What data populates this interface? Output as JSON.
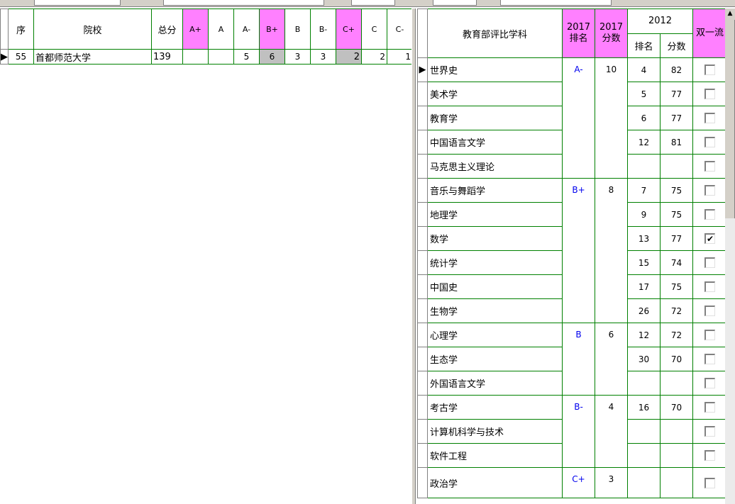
{
  "left_grid": {
    "headers": [
      "序",
      "院校",
      "总分",
      "A+",
      "A",
      "A-",
      "B+",
      "B",
      "B-",
      "C+",
      "C",
      "C-"
    ],
    "row": {
      "seq": "55",
      "school": "首都师范大学",
      "total": "139",
      "a_plus": "",
      "a": "",
      "a_minus": "5",
      "b_plus": "6",
      "b": "3",
      "b_minus": "3",
      "c_plus": "2",
      "c": "2",
      "c_minus": "1"
    }
  },
  "right_grid": {
    "headers": {
      "subject": "教育部评比学科",
      "rank2017": "2017排名",
      "score2017": "2017分数",
      "year2012": "2012",
      "rank2012": "排名",
      "score2012": "分数",
      "double_first": "双一流"
    },
    "groups": [
      {
        "grade": "A-",
        "score": "10",
        "rows": [
          {
            "subject": "世界史",
            "rank": "4",
            "score": "82",
            "checked": false
          },
          {
            "subject": "美术学",
            "rank": "5",
            "score": "77",
            "checked": false
          },
          {
            "subject": "教育学",
            "rank": "6",
            "score": "77",
            "checked": false
          },
          {
            "subject": "中国语言文学",
            "rank": "12",
            "score": "81",
            "checked": false
          },
          {
            "subject": "马克思主义理论",
            "rank": "",
            "score": "",
            "checked": false
          }
        ]
      },
      {
        "grade": "B+",
        "score": "8",
        "rows": [
          {
            "subject": "音乐与舞蹈学",
            "rank": "7",
            "score": "75",
            "checked": false
          },
          {
            "subject": "地理学",
            "rank": "9",
            "score": "75",
            "checked": false
          },
          {
            "subject": "数学",
            "rank": "13",
            "score": "77",
            "checked": true
          },
          {
            "subject": "统计学",
            "rank": "15",
            "score": "74",
            "checked": false
          },
          {
            "subject": "中国史",
            "rank": "17",
            "score": "75",
            "checked": false
          },
          {
            "subject": "生物学",
            "rank": "26",
            "score": "72",
            "checked": false
          }
        ]
      },
      {
        "grade": "B",
        "score": "6",
        "rows": [
          {
            "subject": "心理学",
            "rank": "12",
            "score": "72",
            "checked": false
          },
          {
            "subject": "生态学",
            "rank": "30",
            "score": "70",
            "checked": false
          },
          {
            "subject": "外国语言文学",
            "rank": "",
            "score": "",
            "checked": false
          }
        ]
      },
      {
        "grade": "B-",
        "score": "4",
        "rows": [
          {
            "subject": "考古学",
            "rank": "16",
            "score": "70",
            "checked": false
          },
          {
            "subject": "计算机科学与技术",
            "rank": "",
            "score": "",
            "checked": false
          },
          {
            "subject": "软件工程",
            "rank": "",
            "score": "",
            "checked": false
          }
        ]
      },
      {
        "grade": "C+",
        "score": "3",
        "rows": [
          {
            "subject": "政治学",
            "rank": "",
            "score": "",
            "checked": false
          }
        ]
      }
    ]
  },
  "icons": {
    "row_pointer": "triangle-right-icon",
    "scroll_up": "arrow-up-icon",
    "checkmark": "checkmark-icon"
  },
  "colors": {
    "header_pink": "#ff80ff",
    "grid_line": "#008000",
    "grade_text": "#0000ee",
    "highlight_cell": "#c0c0c0"
  }
}
